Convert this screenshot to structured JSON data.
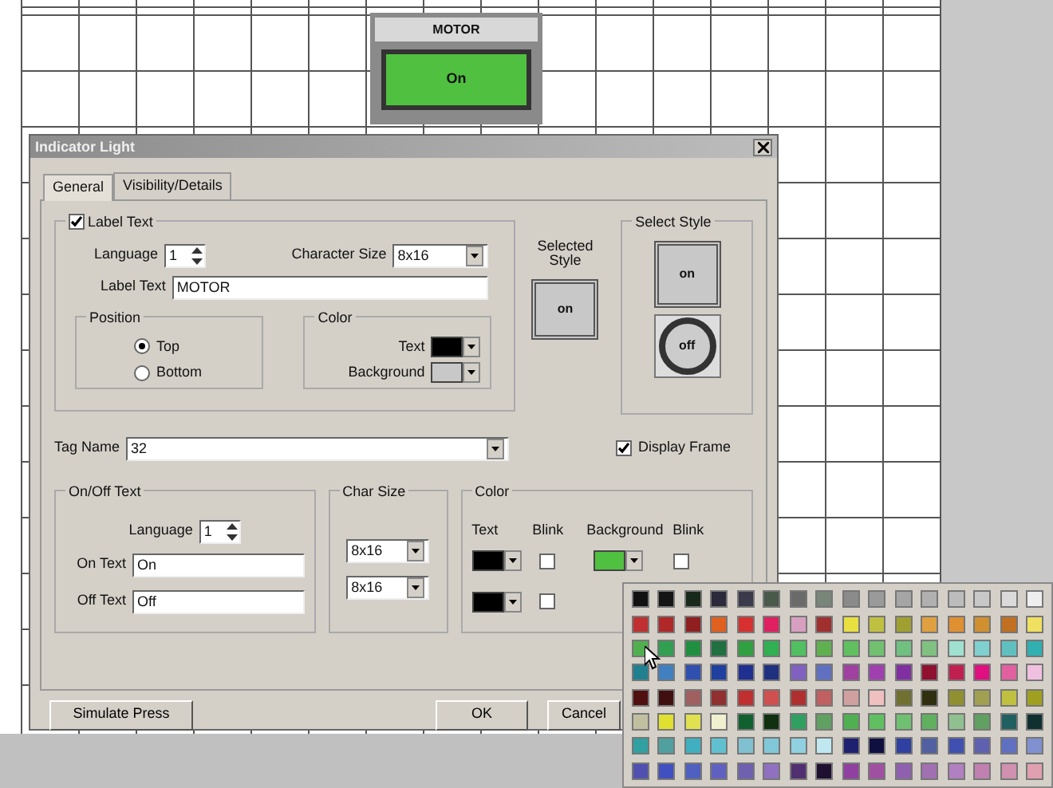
{
  "canvas": {
    "widget": {
      "caption": "MOTOR",
      "state_text": "On"
    }
  },
  "dialog": {
    "title": "Indicator Light",
    "tabs": [
      {
        "label": "General",
        "selected": true
      },
      {
        "label": "Visibility/Details",
        "selected": false
      }
    ],
    "label_group": {
      "title": "Label Text",
      "checked": true,
      "language_label": "Language",
      "language": "1",
      "char_size_label": "Character Size",
      "char_size": "8x16",
      "label_text_label": "Label Text",
      "label_text": "MOTOR",
      "position": {
        "title": "Position",
        "options": [
          {
            "label": "Top",
            "selected": true
          },
          {
            "label": "Bottom",
            "selected": false
          }
        ]
      },
      "color": {
        "title": "Color",
        "swatches": [
          {
            "label": "Text",
            "color": "#000000"
          },
          {
            "label": "Background",
            "color": "#c8c8c8"
          }
        ]
      }
    },
    "selected_style": {
      "label": "Selected Style",
      "preview": "on"
    },
    "select_style": {
      "title": "Select Style",
      "styles": [
        {
          "kind": "square",
          "text": "on"
        },
        {
          "kind": "round",
          "text": "off"
        }
      ]
    },
    "tag_name": {
      "label": "Tag Name",
      "value": "32"
    },
    "display_frame": {
      "label": "Display Frame",
      "checked": true
    },
    "onoff_group": {
      "title": "On/Off Text",
      "language_label": "Language",
      "language": "1",
      "on_label": "On Text",
      "on_value": "On",
      "off_label": "Off Text",
      "off_value": "Off"
    },
    "char_size_group": {
      "title": "Char Size",
      "values": [
        "8x16",
        "8x16"
      ]
    },
    "color_group": {
      "title": "Color",
      "headers": [
        "Text",
        "Blink",
        "Background",
        "Blink"
      ],
      "rows": [
        {
          "text": {
            "color": "#000000"
          },
          "blink": false,
          "background": {
            "color": "#50c040"
          },
          "background_blink": false
        },
        {
          "text": {
            "color": "#000000"
          },
          "blink": false
        }
      ]
    },
    "buttons": [
      "Simulate Press",
      "OK",
      "Cancel"
    ]
  },
  "palette": {
    "swatches": [
      {
        "color": "#111111"
      },
      {
        "color": "#151515"
      },
      {
        "color": "#1a2a1a"
      },
      {
        "color": "#2a2a3a"
      },
      {
        "color": "#3a3a4a"
      },
      {
        "color": "#4a5a4a"
      },
      {
        "color": "#6a6a6a"
      },
      {
        "color": "#7a857a"
      },
      {
        "color": "#8a8a8a"
      },
      {
        "color": "#9a9a9a"
      },
      {
        "color": "#a5a5a5"
      },
      {
        "color": "#b0b0b0"
      },
      {
        "color": "#bcbcbc"
      },
      {
        "color": "#c8c8c8"
      },
      {
        "color": "#dadada"
      },
      {
        "color": "#eeeeee"
      },
      {
        "color": "#c03030"
      },
      {
        "color": "#b02828"
      },
      {
        "color": "#902020"
      },
      {
        "color": "#e06020"
      },
      {
        "color": "#d83030"
      },
      {
        "color": "#e02060"
      },
      {
        "color": "#d8a0c0"
      },
      {
        "color": "#a03030"
      },
      {
        "color": "#e8e040"
      },
      {
        "color": "#c0c040"
      },
      {
        "color": "#a0a030"
      },
      {
        "color": "#e0a040"
      },
      {
        "color": "#e09030"
      },
      {
        "color": "#d09030"
      },
      {
        "color": "#c07020"
      },
      {
        "color": "#f0e060"
      },
      {
        "color": "#50b050"
      },
      {
        "color": "#30a050"
      },
      {
        "color": "#209040"
      },
      {
        "color": "#207040"
      },
      {
        "color": "#30a040"
      },
      {
        "color": "#30b050"
      },
      {
        "color": "#50c060"
      },
      {
        "color": "#60b050"
      },
      {
        "color": "#60c060"
      },
      {
        "color": "#70c070"
      },
      {
        "color": "#70c080"
      },
      {
        "color": "#80c080"
      },
      {
        "color": "#a0e0d0"
      },
      {
        "color": "#80d0d0"
      },
      {
        "color": "#60c0c0"
      },
      {
        "color": "#30b0b0"
      },
      {
        "color": "#208090"
      },
      {
        "color": "#4080c0"
      },
      {
        "color": "#3050b0"
      },
      {
        "color": "#2040a0"
      },
      {
        "color": "#203090"
      },
      {
        "color": "#203080"
      },
      {
        "color": "#8060c0"
      },
      {
        "color": "#6070c0"
      },
      {
        "color": "#a040a0"
      },
      {
        "color": "#a040b0"
      },
      {
        "color": "#8030a0"
      },
      {
        "color": "#901030"
      },
      {
        "color": "#c02050"
      },
      {
        "color": "#e01080"
      },
      {
        "color": "#e060a0"
      },
      {
        "color": "#f0c0e0"
      },
      {
        "color": "#501010"
      },
      {
        "color": "#401010"
      },
      {
        "color": "#a06060"
      },
      {
        "color": "#903030"
      },
      {
        "color": "#c03030"
      },
      {
        "color": "#d05050"
      },
      {
        "color": "#b03030"
      },
      {
        "color": "#c06060"
      },
      {
        "color": "#d0a0a0"
      },
      {
        "color": "#f0c0c0"
      },
      {
        "color": "#707030"
      },
      {
        "color": "#303010"
      },
      {
        "color": "#909030"
      },
      {
        "color": "#a0a050"
      },
      {
        "color": "#c0c040"
      },
      {
        "color": "#a0a020"
      },
      {
        "color": "#c0c0a0"
      },
      {
        "color": "#e0e030"
      },
      {
        "color": "#e0e050"
      },
      {
        "color": "#f0f0d0"
      },
      {
        "color": "#106030"
      },
      {
        "color": "#103010"
      },
      {
        "color": "#30a060"
      },
      {
        "color": "#60a060"
      },
      {
        "color": "#50b051"
      },
      {
        "color": "#60c061"
      },
      {
        "color": "#70c071"
      },
      {
        "color": "#60b060"
      },
      {
        "color": "#90c090"
      },
      {
        "color": "#60a061"
      },
      {
        "color": "#206060"
      },
      {
        "color": "#103030"
      },
      {
        "color": "#30a0a0"
      },
      {
        "color": "#50a0a0"
      },
      {
        "color": "#40b0c0"
      },
      {
        "color": "#60c0d0"
      },
      {
        "color": "#80c0d0"
      },
      {
        "color": "#80c8d8"
      },
      {
        "color": "#90d0e0"
      },
      {
        "color": "#c0e8f0"
      },
      {
        "color": "#202070"
      },
      {
        "color": "#101040"
      },
      {
        "color": "#3040a0"
      },
      {
        "color": "#5060a0"
      },
      {
        "color": "#4050b0"
      },
      {
        "color": "#6060b0"
      },
      {
        "color": "#6070c1"
      },
      {
        "color": "#8090d0"
      },
      {
        "color": "#5050b0"
      },
      {
        "color": "#4050c0"
      },
      {
        "color": "#5060c0"
      },
      {
        "color": "#6060c0"
      },
      {
        "color": "#7060b0"
      },
      {
        "color": "#9070c0"
      },
      {
        "color": "#503070"
      },
      {
        "color": "#201030"
      },
      {
        "color": "#9040a0"
      },
      {
        "color": "#a050a0"
      },
      {
        "color": "#9060b0"
      },
      {
        "color": "#a070b0"
      },
      {
        "color": "#b080c0"
      },
      {
        "color": "#c080b0"
      },
      {
        "color": "#d090b0"
      },
      {
        "color": "#e0a0b0"
      }
    ]
  }
}
